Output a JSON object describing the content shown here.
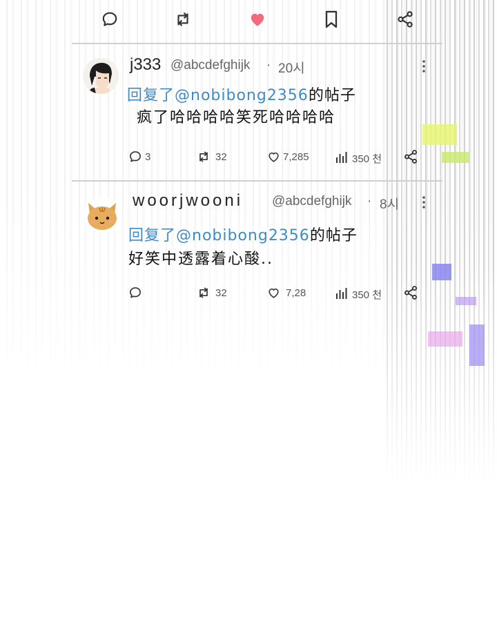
{
  "posts": [
    {
      "name": "j333",
      "handle": "@abcdefghijk",
      "separator": "·",
      "time": "20시",
      "reply_prefix": "回复了@nobibong2356",
      "reply_suffix": "的帖子",
      "body": "疯了哈哈哈哈笑死哈哈哈哈",
      "replies": "3",
      "reposts": "32",
      "likes": "7,285",
      "views": "350 천"
    },
    {
      "name": "woorjwooni",
      "handle": "@abcdefghijk",
      "separator": "·",
      "time": "8시",
      "reply_prefix": "回复了@nobibong2356",
      "reply_suffix": "的帖子",
      "body": "好笑中透露着心酸..",
      "replies": "",
      "reposts": "32",
      "likes": "7,28",
      "views": "350 천"
    }
  ],
  "colors": {
    "like_active": "#f26b7a",
    "reply_link": "#3f8bc4"
  },
  "icons": {
    "top_bar": [
      "comment-icon",
      "repost-icon",
      "heart-filled-icon",
      "bookmark-icon",
      "share-icon"
    ],
    "stats": [
      "comment-icon",
      "repost-icon",
      "heart-icon",
      "views-icon",
      "share-icon"
    ]
  }
}
